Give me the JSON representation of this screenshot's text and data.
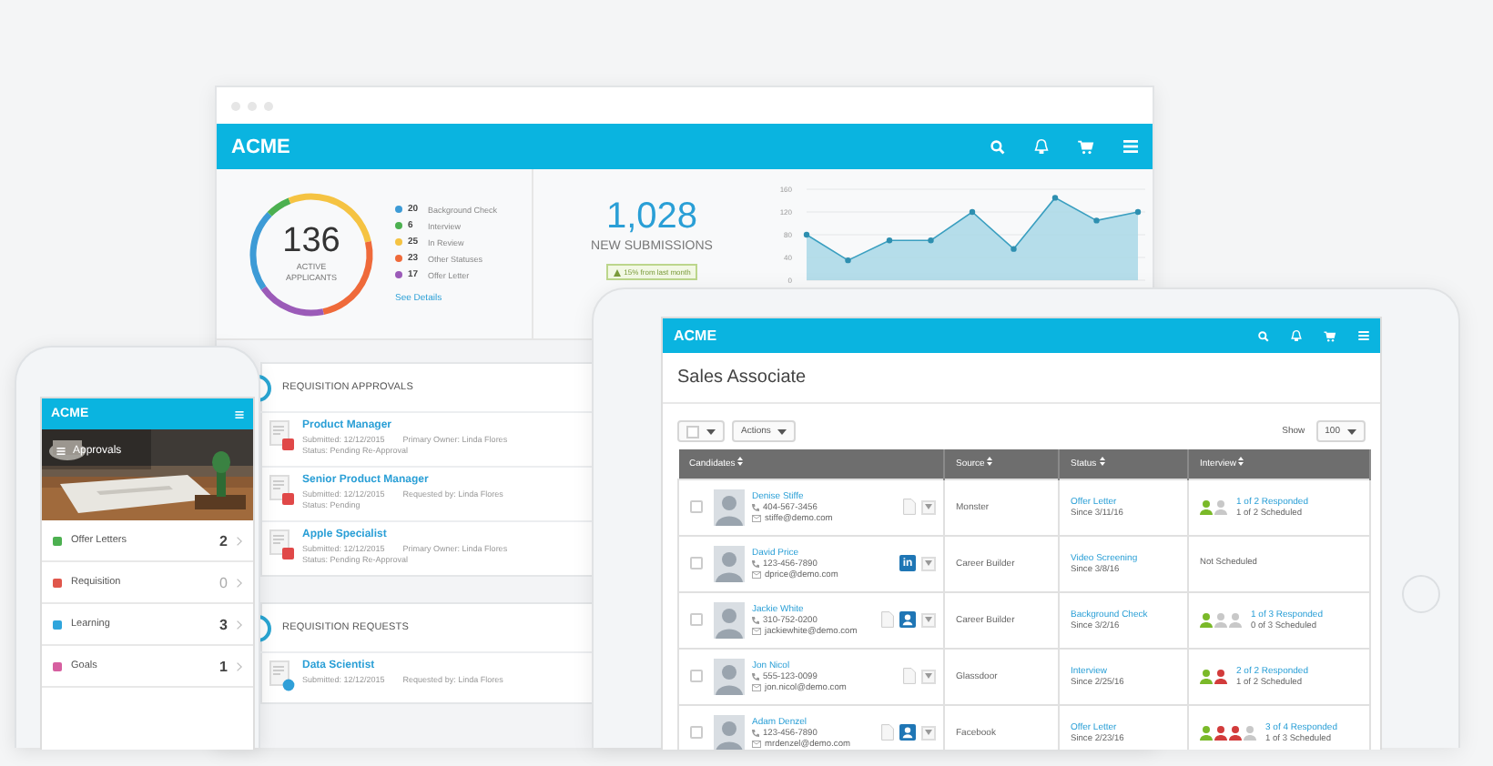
{
  "desktop": {
    "logo": "ACME",
    "applicants": {
      "value": "136",
      "label": "ACTIVE APPLICANTS",
      "link": "See Details",
      "legend": [
        {
          "count": "20",
          "label": "Background Check",
          "color": "#3d9bd6"
        },
        {
          "count": "6",
          "label": "Interview",
          "color": "#4cb050"
        },
        {
          "count": "25",
          "label": "In Review",
          "color": "#f5c342"
        },
        {
          "count": "23",
          "label": "Other Statuses",
          "color": "#ef6a3a"
        },
        {
          "count": "17",
          "label": "Offer Letter",
          "color": "#9b5bb8"
        }
      ]
    },
    "submissions": {
      "value": "1,028",
      "label": "NEW SUBMISSIONS",
      "change": "15% from last month"
    },
    "chart_data": {
      "type": "area",
      "grid": true,
      "ylim": [
        0,
        160
      ],
      "yticks": [
        0,
        40,
        80,
        120,
        160
      ],
      "values": [
        80,
        35,
        70,
        70,
        120,
        55,
        145,
        105,
        120
      ]
    },
    "sections": [
      {
        "title": "REQUISITION APPROVALS",
        "items": [
          {
            "kind": "approval",
            "title": "Product Manager",
            "submitted": "Submitted: 12/12/2015",
            "owner": "Primary Owner: Linda Flores",
            "status": "Status: Pending Re-Approval"
          },
          {
            "kind": "approval",
            "title": "Senior Product Manager",
            "submitted": "Submitted: 12/12/2015",
            "owner": "Requested by: Linda Flores",
            "status": "Status: Pending"
          },
          {
            "kind": "approval",
            "title": "Apple Specialist",
            "submitted": "Submitted: 12/12/2015",
            "owner": "Primary Owner: Linda Flores",
            "status": "Status: Pending Re-Approval"
          }
        ]
      },
      {
        "title": "REQUISITION REQUESTS",
        "items": [
          {
            "kind": "request",
            "title": "Data Scientist",
            "submitted": "Submitted: 12/12/2015",
            "owner": "Requested by: Linda Flores"
          }
        ]
      }
    ]
  },
  "tablet": {
    "logo": "ACME",
    "title": "Sales Associate",
    "actions": "Actions",
    "show_label": "Show",
    "show_value": "100",
    "columns": [
      "Candidates",
      "Source",
      "Status",
      "Interview"
    ],
    "rows": [
      {
        "checked": false,
        "name": "Denise Stiffe",
        "phone": "404-567-3456",
        "email": "stiffe@demo.com",
        "attachments": [
          {
            "kind": "resume"
          }
        ],
        "source": "Monster",
        "status": "Offer Letter",
        "since": "Since 3/11/16",
        "interviewers": [
          {
            "color": "#7ab929"
          },
          {
            "color": "#c8c8c8"
          }
        ],
        "responded": "1 of 2 Responded",
        "scheduled": "1 of 2 Scheduled"
      },
      {
        "checked": false,
        "name": "David Price",
        "phone": "123-456-7890",
        "email": "dprice@demo.com",
        "attachments": [
          {
            "kind": "linkedin",
            "label": "in"
          }
        ],
        "source": "Career Builder",
        "status": "Video Screening",
        "since": "Since 3/8/16",
        "scheduled": "Not Scheduled"
      },
      {
        "checked": false,
        "name": "Jackie White",
        "phone": "310-752-0200",
        "email": "jackiewhite@demo.com",
        "attachments": [
          {
            "kind": "resume"
          },
          {
            "kind": "profile"
          }
        ],
        "source": "Career Builder",
        "status": "Background Check",
        "since": "Since 3/2/16",
        "interviewers": [
          {
            "color": "#7ab929"
          },
          {
            "color": "#c8c8c8"
          },
          {
            "color": "#c8c8c8"
          }
        ],
        "responded": "1 of 3 Responded",
        "scheduled": "0 of 3 Scheduled"
      },
      {
        "checked": false,
        "name": "Jon Nicol",
        "phone": "555-123-0099",
        "email": "jon.nicol@demo.com",
        "attachments": [
          {
            "kind": "resume"
          }
        ],
        "source": "Glassdoor",
        "status": "Interview",
        "since": "Since 2/25/16",
        "interviewers": [
          {
            "color": "#7ab929"
          },
          {
            "color": "#d23b3b"
          }
        ],
        "responded": "2 of 2 Responded",
        "scheduled": "1 of 2 Scheduled"
      },
      {
        "checked": false,
        "name": "Adam Denzel",
        "phone": "123-456-7890",
        "email": "mrdenzel@demo.com",
        "attachments": [
          {
            "kind": "resume"
          },
          {
            "kind": "profile"
          }
        ],
        "source": "Facebook",
        "status": "Offer Letter",
        "since": "Since 2/23/16",
        "interviewers": [
          {
            "color": "#7ab929"
          },
          {
            "color": "#d23b3b"
          },
          {
            "color": "#d23b3b"
          },
          {
            "color": "#c8c8c8"
          }
        ],
        "responded": "3 of 4 Responded",
        "scheduled": "1 of 3 Scheduled"
      }
    ]
  },
  "phone": {
    "logo": "ACME",
    "banner": "Approvals",
    "items": [
      {
        "label": "Offer Letters",
        "count": "2",
        "dimmed": false
      },
      {
        "label": "Requisition",
        "count": "0",
        "dimmed": true
      },
      {
        "label": "Learning",
        "count": "3",
        "dimmed": false
      },
      {
        "label": "Goals",
        "count": "1",
        "dimmed": false
      }
    ]
  }
}
